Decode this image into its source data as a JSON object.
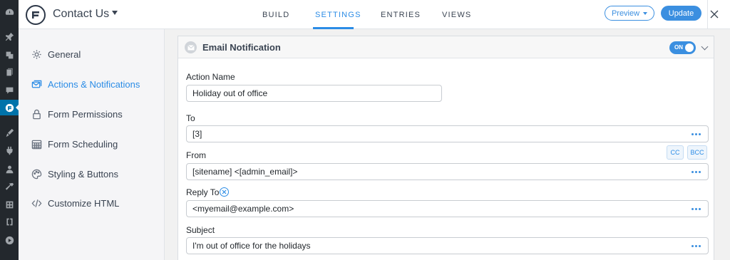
{
  "header": {
    "form_title": "Contact Us",
    "tabs": [
      {
        "label": "BUILD"
      },
      {
        "label": "SETTINGS"
      },
      {
        "label": "ENTRIES"
      },
      {
        "label": "VIEWS"
      }
    ],
    "active_tab": "SETTINGS",
    "preview_label": "Preview",
    "update_label": "Update"
  },
  "sidebar": {
    "items": [
      {
        "label": "General",
        "icon": "gear-icon"
      },
      {
        "label": "Actions & Notifications",
        "icon": "actions-icon"
      },
      {
        "label": "Form Permissions",
        "icon": "lock-icon"
      },
      {
        "label": "Form Scheduling",
        "icon": "calendar-icon"
      },
      {
        "label": "Styling & Buttons",
        "icon": "palette-icon"
      },
      {
        "label": "Customize HTML",
        "icon": "code-icon"
      }
    ],
    "active_item": "Actions & Notifications"
  },
  "action": {
    "title": "Email Notification",
    "toggle_label": "ON",
    "fields": {
      "action_name": {
        "label": "Action Name",
        "value": "Holiday out of office"
      },
      "to": {
        "label": "To",
        "value": "[3]"
      },
      "from": {
        "label": "From",
        "value": "[sitename] <[admin_email]>"
      },
      "reply_to": {
        "label": "Reply To",
        "value": "<myemail@example.com>"
      },
      "subject": {
        "label": "Subject",
        "value": "I'm out of office for the holidays"
      }
    },
    "cc_label": "CC",
    "bcc_label": "BCC"
  },
  "colors": {
    "accent": "#3b8fe0",
    "wp_sidebar": "#23282d",
    "wp_active": "#0073aa"
  }
}
